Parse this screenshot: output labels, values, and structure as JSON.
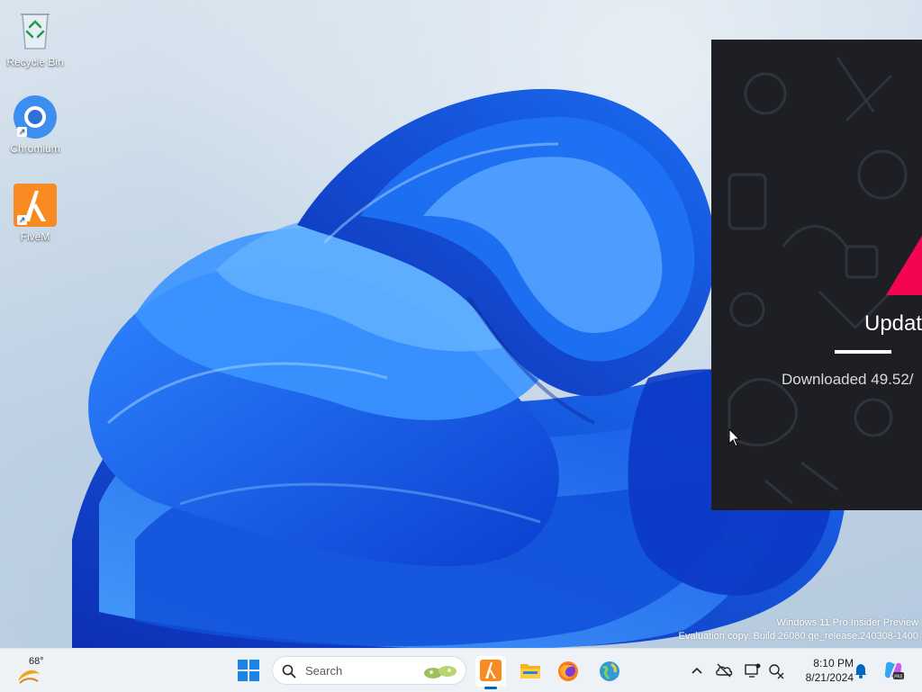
{
  "desktop": {
    "icons": [
      {
        "label": "Recycle Bin",
        "icon": "recycle-bin-icon"
      },
      {
        "label": "Chromium",
        "icon": "chromium-icon"
      },
      {
        "label": "FiveM",
        "icon": "fivem-icon"
      }
    ],
    "watermark_line1": "Windows 11 Pro Insider Preview",
    "watermark_line2": "Evaluation copy. Build 26080.ge_release.240308-1400"
  },
  "updater": {
    "title": "Updat",
    "status": "Downloaded 49.52/",
    "progress_fraction": 0.27,
    "accent": "#f40552",
    "background": "#1d1f25"
  },
  "taskbar": {
    "weather": {
      "temp": "68°",
      "icon": "sun-icon"
    },
    "search": {
      "placeholder": "Search"
    },
    "apps": [
      {
        "name": "fivem-taskbar-icon",
        "active": true
      },
      {
        "name": "file-explorer-icon",
        "active": false
      },
      {
        "name": "firefox-icon",
        "active": false
      },
      {
        "name": "globe-app-icon",
        "active": false
      }
    ],
    "tray": [
      "chevron-up-icon",
      "cloud-sync-icon",
      "display-icon",
      "network-icon"
    ],
    "clock": {
      "time": "8:10 PM",
      "date": "8/21/2024"
    },
    "accent": "#0067c0"
  }
}
